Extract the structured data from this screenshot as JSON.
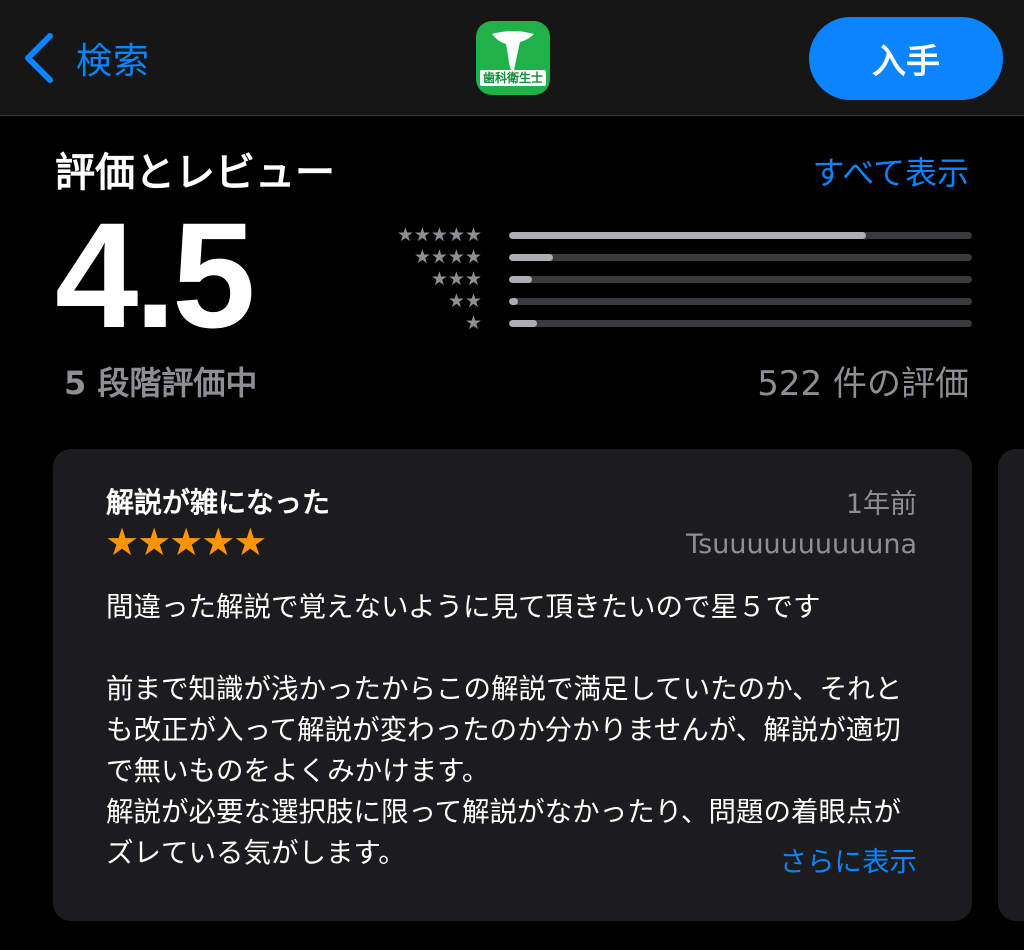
{
  "navbar": {
    "back_label": "検索",
    "app_icon_text": "歯科衛生士",
    "get_label": "入手"
  },
  "ratings": {
    "section_title": "評価とレビュー",
    "see_all": "すべて表示",
    "score": "4.5",
    "out_of": "5 段階評価中",
    "count": "522 件の評価",
    "histogram": [
      {
        "stars": "★★★★★",
        "fraction": 0.77
      },
      {
        "stars": "★★★★",
        "fraction": 0.095
      },
      {
        "stars": "★★★",
        "fraction": 0.05
      },
      {
        "stars": "★★",
        "fraction": 0.02
      },
      {
        "stars": "★",
        "fraction": 0.06
      }
    ]
  },
  "review": {
    "title": "解説が雑になった",
    "date": "1年前",
    "stars": "★★★★★",
    "author": "Tsuuuuuuuuuuna",
    "body": "間違った解説で覚えないように見て頂きたいので星５です\n\n前まで知識が浅かったからこの解説で満足していたのか、それとも改正が入って解説が変わったのか分かりませんが、解説が適切で無いものをよくみかけます。\n解説が必要な選択肢に限って解説がなかったり、問題の着眼点がズレている気がします。",
    "more": "さらに表示"
  },
  "colors": {
    "accent": "#0a84ff",
    "star": "#ff9500",
    "app_icon": "#20b24a"
  }
}
